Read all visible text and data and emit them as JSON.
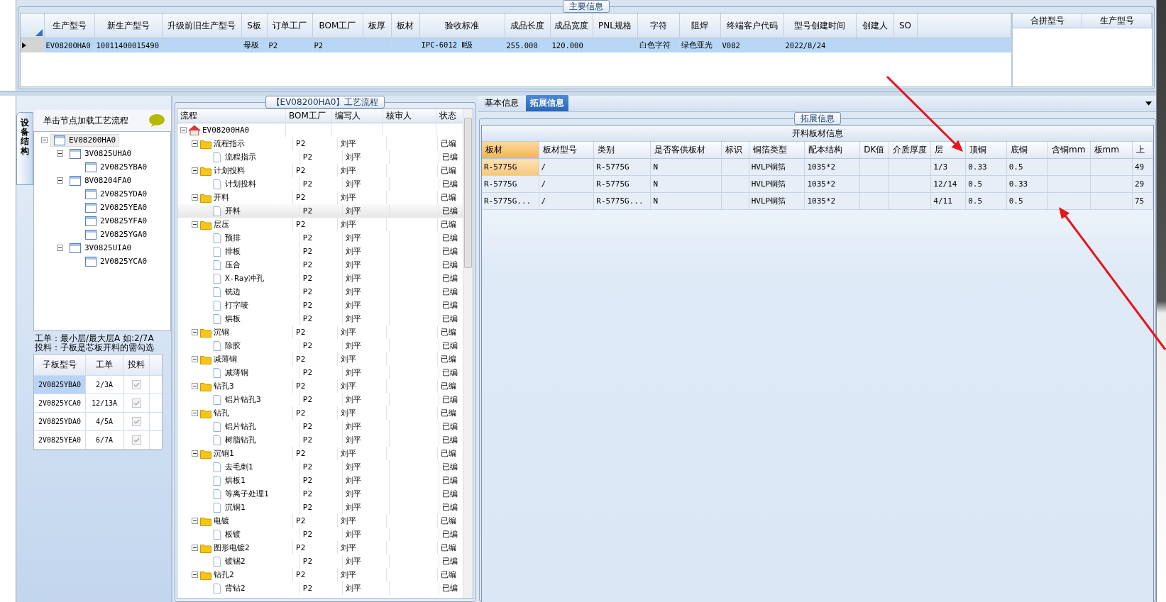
{
  "main_info": {
    "title": "主要信息",
    "columns": [
      "生产型号",
      "新生产型号",
      "升级前旧生产型号",
      "S板",
      "订单工厂",
      "BOM工厂",
      "板厚",
      "板材",
      "验收标准",
      "成品长度",
      "成品宽度",
      "PNL规格",
      "字符",
      "阻焊",
      "终端客户代码",
      "型号创建时间",
      "创建人",
      "SO"
    ],
    "rows": [
      {
        "selected": true,
        "cells": [
          "EV08200HA0",
          "10011400015490",
          null,
          "母板",
          "P2",
          "P2",
          null,
          null,
          "IPC-6012 Ⅱ级",
          "255.000",
          "120.000",
          null,
          "白色字符",
          "绿色亚光",
          "V082",
          "2022/8/24",
          null,
          null
        ]
      }
    ]
  },
  "merge_table": {
    "columns": [
      "合拼型号",
      "生产型号"
    ]
  },
  "structure": {
    "tab": "设备结构",
    "header": "单击节点加载工艺流程",
    "tree": [
      {
        "label": "EV08200HA0",
        "selected": true,
        "expanded": true,
        "children": [
          {
            "label": "3V0825UHA0",
            "selected": false,
            "expanded": true,
            "children": [
              {
                "label": "2V0825YBA0",
                "selected": false
              }
            ]
          },
          {
            "label": "8V08204FA0",
            "selected": false,
            "expanded": true,
            "children": [
              {
                "label": "2V0825YDA0",
                "selected": false
              },
              {
                "label": "2V0825YEA0",
                "selected": false
              },
              {
                "label": "2V0825YFA0",
                "selected": false
              },
              {
                "label": "2V0825YGA0",
                "selected": false
              }
            ]
          },
          {
            "label": "3V0825UIA0",
            "selected": false,
            "expanded": true,
            "children": [
              {
                "label": "2V0825YCA0",
                "selected": false
              }
            ]
          }
        ]
      }
    ],
    "notes": [
      "工单：最小层/最大层A 如:2/7A",
      "投料：子板是芯板开料的需勾选"
    ],
    "sub_columns": [
      "子板型号",
      "工单",
      "投料"
    ],
    "sub_rows": [
      {
        "board": "2V0825YBA0",
        "order": "2/3A",
        "checked": true,
        "disabled": true,
        "selected": true
      },
      {
        "board": "2V0825YCA0",
        "order": "12/13A",
        "checked": true,
        "disabled": true,
        "selected": false
      },
      {
        "board": "2V0825YDA0",
        "order": "4/5A",
        "checked": true,
        "disabled": true,
        "selected": false
      },
      {
        "board": "2V0825YEA0",
        "order": "6/7A",
        "checked": true,
        "disabled": true,
        "selected": false
      }
    ]
  },
  "process": {
    "title": "【EV08200HA0】工艺流程",
    "columns": [
      "流程",
      "BOM工厂",
      "编写人",
      "核审人",
      "状态"
    ],
    "tree": [
      {
        "kind": "root",
        "label": "EV08200HA0",
        "expanded": true,
        "selected": false,
        "children": [
          {
            "kind": "folder",
            "label": "流程指示",
            "bom": "P2",
            "writer": "刘平",
            "status": "已编",
            "expanded": true,
            "selected": false,
            "children": [
              {
                "kind": "step",
                "label": "流程指示",
                "bom": "P2",
                "writer": "刘平",
                "status": "已编",
                "selected": false
              }
            ]
          },
          {
            "kind": "folder",
            "label": "计划投料",
            "bom": "P2",
            "writer": "刘平",
            "status": "已编",
            "expanded": true,
            "selected": false,
            "children": [
              {
                "kind": "step",
                "label": "计划投料",
                "bom": "P2",
                "writer": "刘平",
                "status": "已编",
                "selected": false
              }
            ]
          },
          {
            "kind": "folder",
            "label": "开料",
            "bom": "P2",
            "writer": "刘平",
            "status": "已编",
            "expanded": true,
            "selected": false,
            "children": [
              {
                "kind": "step",
                "label": "开料",
                "bom": "P2",
                "writer": "刘平",
                "status": "已编",
                "selected": true
              }
            ]
          },
          {
            "kind": "folder",
            "label": "层压",
            "bom": "P2",
            "writer": "刘平",
            "status": "已编",
            "expanded": true,
            "selected": false,
            "children": [
              {
                "kind": "step",
                "label": "预排",
                "bom": "P2",
                "writer": "刘平",
                "status": "已编",
                "selected": false
              },
              {
                "kind": "step",
                "label": "排板",
                "bom": "P2",
                "writer": "刘平",
                "status": "已编",
                "selected": false
              },
              {
                "kind": "step",
                "label": "压合",
                "bom": "P2",
                "writer": "刘平",
                "status": "已编",
                "selected": false
              },
              {
                "kind": "step",
                "label": "X-Ray冲孔",
                "bom": "P2",
                "writer": "刘平",
                "status": "已编",
                "selected": false
              },
              {
                "kind": "step",
                "label": "铣边",
                "bom": "P2",
                "writer": "刘平",
                "status": "已编",
                "selected": false
              },
              {
                "kind": "step",
                "label": "打字唛",
                "bom": "P2",
                "writer": "刘平",
                "status": "已编",
                "selected": false
              },
              {
                "kind": "step",
                "label": "烘板",
                "bom": "P2",
                "writer": "刘平",
                "status": "已编",
                "selected": false
              }
            ]
          },
          {
            "kind": "folder",
            "label": "沉铜",
            "bom": "P2",
            "writer": "刘平",
            "status": "已编",
            "expanded": true,
            "selected": false,
            "children": [
              {
                "kind": "step",
                "label": "除胶",
                "bom": "P2",
                "writer": "刘平",
                "status": "已编",
                "selected": false
              }
            ]
          },
          {
            "kind": "folder",
            "label": "减薄铜",
            "bom": "P2",
            "writer": "刘平",
            "status": "已编",
            "expanded": true,
            "selected": false,
            "children": [
              {
                "kind": "step",
                "label": "减薄铜",
                "bom": "P2",
                "writer": "刘平",
                "status": "已编",
                "selected": false
              }
            ]
          },
          {
            "kind": "folder",
            "label": "钻孔3",
            "bom": "P2",
            "writer": "刘平",
            "status": "已编",
            "expanded": true,
            "selected": false,
            "children": [
              {
                "kind": "step",
                "label": "铝片钻孔3",
                "bom": "P2",
                "writer": "刘平",
                "status": "已编",
                "selected": false
              }
            ]
          },
          {
            "kind": "folder",
            "label": "钻孔",
            "bom": "P2",
            "writer": "刘平",
            "status": "已编",
            "expanded": true,
            "selected": false,
            "children": [
              {
                "kind": "step",
                "label": "铝片钻孔",
                "bom": "P2",
                "writer": "刘平",
                "status": "已编",
                "selected": false
              },
              {
                "kind": "step",
                "label": "树脂钻孔",
                "bom": "P2",
                "writer": "刘平",
                "status": "已编",
                "selected": false
              }
            ]
          },
          {
            "kind": "folder",
            "label": "沉铜1",
            "bom": "P2",
            "writer": "刘平",
            "status": "已编",
            "expanded": true,
            "selected": false,
            "children": [
              {
                "kind": "step",
                "label": "去毛刺1",
                "bom": "P2",
                "writer": "刘平",
                "status": "已编",
                "selected": false
              },
              {
                "kind": "step",
                "label": "烘板1",
                "bom": "P2",
                "writer": "刘平",
                "status": "已编",
                "selected": false
              },
              {
                "kind": "step",
                "label": "等离子处理1",
                "bom": "P2",
                "writer": "刘平",
                "status": "已编",
                "selected": false
              },
              {
                "kind": "step",
                "label": "沉铜1",
                "bom": "P2",
                "writer": "刘平",
                "status": "已编",
                "selected": false
              }
            ]
          },
          {
            "kind": "folder",
            "label": "电镀",
            "bom": "P2",
            "writer": "刘平",
            "status": "已编",
            "expanded": true,
            "selected": false,
            "children": [
              {
                "kind": "step",
                "label": "板镀",
                "bom": "P2",
                "writer": "刘平",
                "status": "已编",
                "selected": false
              }
            ]
          },
          {
            "kind": "folder",
            "label": "图形电镀2",
            "bom": "P2",
            "writer": "刘平",
            "status": "已编",
            "expanded": true,
            "selected": false,
            "children": [
              {
                "kind": "step",
                "label": "镀锡2",
                "bom": "P2",
                "writer": "刘平",
                "status": "已编",
                "selected": false
              }
            ]
          },
          {
            "kind": "folder",
            "label": "钻孔2",
            "bom": "P2",
            "writer": "刘平",
            "status": "已编",
            "expanded": true,
            "selected": false,
            "children": [
              {
                "kind": "step",
                "label": "背钻2",
                "bom": "P2",
                "writer": "刘平",
                "status": "已编",
                "selected": false
              }
            ]
          }
        ]
      }
    ]
  },
  "detail": {
    "tabs": [
      {
        "label": "基本信息",
        "selected": false
      },
      {
        "label": "拓展信息",
        "selected": true
      }
    ],
    "group_title": "拓展信息",
    "table_title": "开料板材信息",
    "columns": [
      "板材",
      "板材型号",
      "类别",
      "是否客供板材",
      "标识",
      "铜箔类型",
      "配本结构",
      "DK值",
      "介质厚度",
      "层",
      "顶铜",
      "底铜",
      "含铜mm",
      "板mm",
      "上"
    ],
    "rows": [
      {
        "selected": true,
        "cells": [
          "R-5775G",
          "/",
          "R-5775G",
          "N",
          null,
          "HVLP铜箔",
          "1035*2",
          null,
          null,
          "1/3",
          "0.33",
          "0.5",
          null,
          null,
          "49"
        ]
      },
      {
        "selected": false,
        "cells": [
          "R-5775G",
          "/",
          "R-5775G",
          "N",
          null,
          "HVLP铜箔",
          "1035*2",
          null,
          null,
          "12/14",
          "0.5",
          "0.33",
          null,
          null,
          "29"
        ]
      },
      {
        "selected": false,
        "cells": [
          "R-5775G...",
          "/",
          "R-5775G...",
          "N",
          null,
          "HVLP铜箔",
          "1035*2",
          null,
          null,
          "4/11",
          "0.5",
          "0.5",
          null,
          null,
          "75"
        ]
      }
    ]
  }
}
